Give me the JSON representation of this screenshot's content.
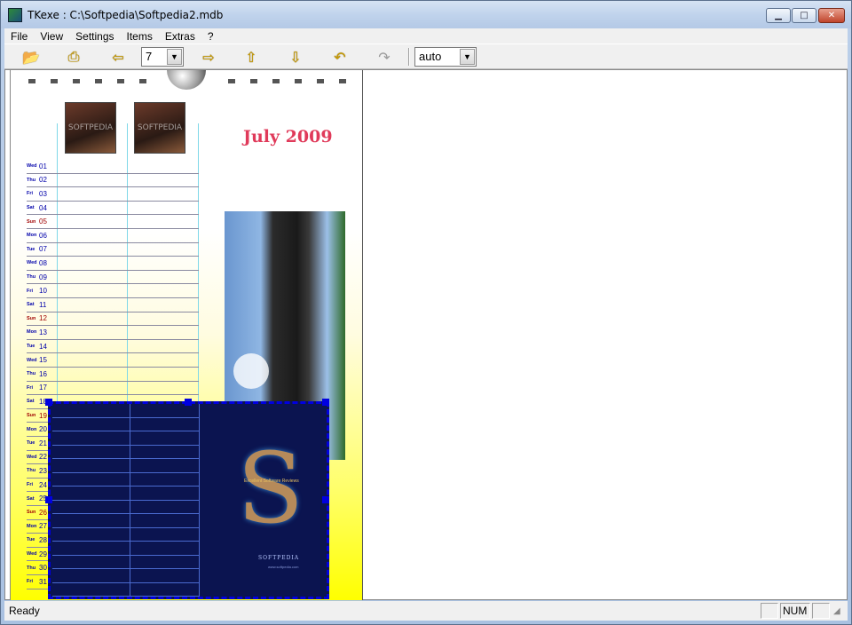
{
  "window": {
    "title": "TKexe : C:\\Softpedia\\Softpedia2.mdb"
  },
  "menu": [
    "File",
    "View",
    "Settings",
    "Items",
    "Extras",
    "?"
  ],
  "toolbar": {
    "page_number": "7",
    "zoom": "auto",
    "icons": [
      "open-icon",
      "print-icon",
      "arrow-left-icon",
      "arrow-right-icon",
      "arrow-up-icon",
      "arrow-down-icon",
      "undo-icon",
      "redo-icon"
    ]
  },
  "calendar": {
    "title": "July 2009",
    "days": [
      {
        "name": "Wed",
        "num": "01"
      },
      {
        "name": "Thu",
        "num": "02"
      },
      {
        "name": "Fri",
        "num": "03"
      },
      {
        "name": "Sat",
        "num": "04"
      },
      {
        "name": "Sun",
        "num": "05"
      },
      {
        "name": "Mon",
        "num": "06"
      },
      {
        "name": "Tue",
        "num": "07"
      },
      {
        "name": "Wed",
        "num": "08"
      },
      {
        "name": "Thu",
        "num": "09"
      },
      {
        "name": "Fri",
        "num": "10"
      },
      {
        "name": "Sat",
        "num": "11"
      },
      {
        "name": "Sun",
        "num": "12"
      },
      {
        "name": "Mon",
        "num": "13"
      },
      {
        "name": "Tue",
        "num": "14"
      },
      {
        "name": "Wed",
        "num": "15"
      },
      {
        "name": "Thu",
        "num": "16"
      },
      {
        "name": "Fri",
        "num": "17"
      },
      {
        "name": "Sat",
        "num": "18"
      },
      {
        "name": "Sun",
        "num": "19"
      },
      {
        "name": "Mon",
        "num": "20"
      },
      {
        "name": "Tue",
        "num": "21"
      },
      {
        "name": "Wed",
        "num": "22"
      },
      {
        "name": "Thu",
        "num": "23"
      },
      {
        "name": "Fri",
        "num": "24"
      },
      {
        "name": "Sat",
        "num": "25"
      },
      {
        "name": "Sun",
        "num": "26"
      },
      {
        "name": "Mon",
        "num": "27"
      },
      {
        "name": "Tue",
        "num": "28"
      },
      {
        "name": "Wed",
        "num": "29"
      },
      {
        "name": "Thu",
        "num": "30"
      },
      {
        "name": "Fri",
        "num": "31"
      }
    ],
    "photo_watermark": "SOFTPEDIA",
    "logo": {
      "letter": "S",
      "tagline": "Excellent Software Reviews",
      "brand": "SOFTPEDIA",
      "url": "www.softpedia.com"
    }
  },
  "status": {
    "text": "Ready",
    "num": "NUM"
  },
  "colors": {
    "title": "#e03a5a",
    "selection": "#0000e0",
    "weekday": "#0000aa",
    "sunday": "#a00000"
  }
}
